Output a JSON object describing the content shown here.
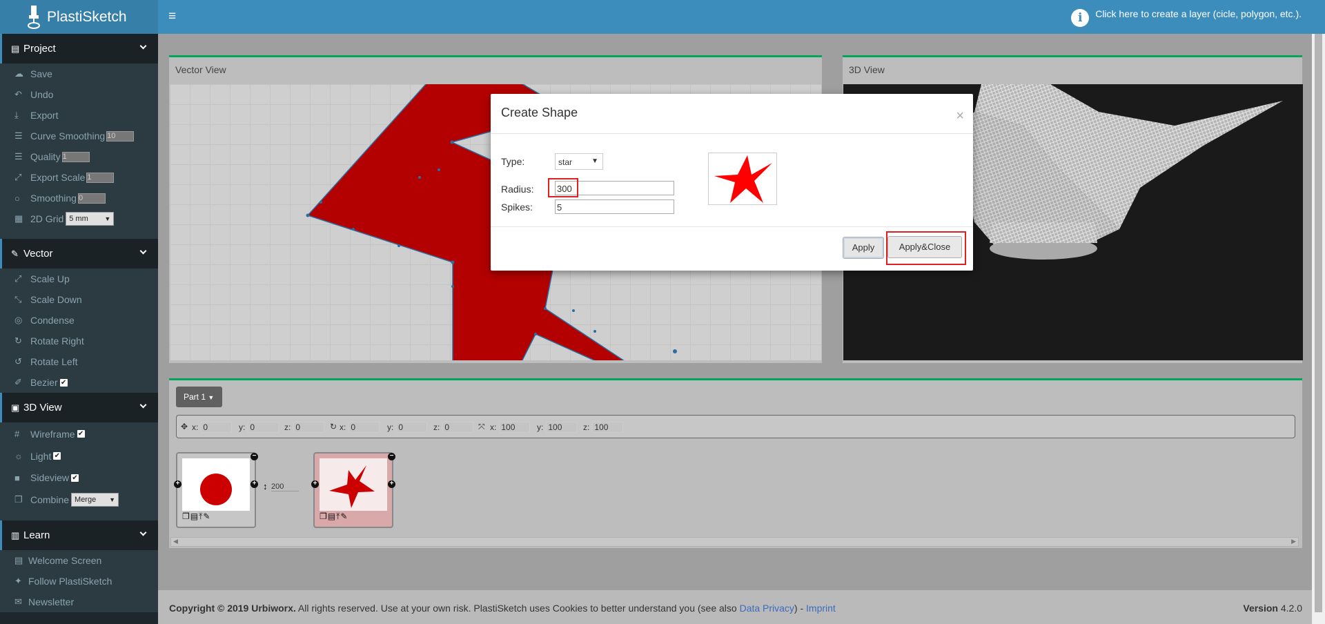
{
  "app": {
    "title": "PlastiSketch",
    "topbar_hint": "Click here to create a layer (cicle, polygon, etc.)."
  },
  "sidebar": {
    "project": {
      "title": "Project",
      "items": [
        {
          "label": "Save",
          "icon": "cloud-upload-icon"
        },
        {
          "label": "Undo",
          "icon": "undo-icon"
        },
        {
          "label": "Export",
          "icon": "download-icon"
        },
        {
          "label": "Curve Smoothing",
          "icon": "sliders-icon",
          "value": "10"
        },
        {
          "label": "Quality",
          "icon": "sliders-icon",
          "value": "1"
        },
        {
          "label": "Export Scale",
          "icon": "expand-icon",
          "value": "1"
        },
        {
          "label": "Smoothing",
          "icon": "circle-icon",
          "value": "0"
        },
        {
          "label": "2D Grid",
          "icon": "grid-icon",
          "value": "5 mm"
        }
      ]
    },
    "vector": {
      "title": "Vector",
      "items": [
        {
          "label": "Scale Up",
          "icon": "expand-arrows-icon"
        },
        {
          "label": "Scale Down",
          "icon": "compress-arrows-icon"
        },
        {
          "label": "Condense",
          "icon": "target-icon"
        },
        {
          "label": "Rotate Right",
          "icon": "rotate-right-icon"
        },
        {
          "label": "Rotate Left",
          "icon": "rotate-left-icon"
        },
        {
          "label": "Bezier",
          "icon": "brush-icon",
          "checked": true
        }
      ]
    },
    "view3d": {
      "title": "3D View",
      "items": [
        {
          "label": "Wireframe",
          "icon": "hash-icon",
          "checked": true
        },
        {
          "label": "Light",
          "icon": "lightbulb-icon",
          "checked": true
        },
        {
          "label": "Sideview",
          "icon": "camera-icon",
          "checked": true
        },
        {
          "label": "Combine",
          "icon": "copy-icon",
          "value": "Merge"
        }
      ]
    },
    "learn": {
      "title": "Learn",
      "items": [
        {
          "label": "Welcome Screen",
          "icon": "film-icon"
        },
        {
          "label": "Follow PlastiSketch",
          "icon": "twitter-icon"
        },
        {
          "label": "Newsletter",
          "icon": "envelope-icon"
        }
      ]
    }
  },
  "panels": {
    "vector_title": "Vector View",
    "view3d_title": "3D View"
  },
  "parts": {
    "dropdown": "Part 1",
    "transform": {
      "x": "0",
      "y": "0",
      "z": "0",
      "rx": "0",
      "ry": "0",
      "rz": "0",
      "sx": "100",
      "sy": "100",
      "sz": "100"
    },
    "layer_gap": "200"
  },
  "modal": {
    "title": "Create Shape",
    "close": "×",
    "type_label": "Type:",
    "type_value": "star",
    "radius_label": "Radius:",
    "radius_value": "300",
    "spikes_label": "Spikes:",
    "spikes_value": "5",
    "apply": "Apply",
    "apply_close": "Apply&Close"
  },
  "footer": {
    "copyright": "Copyright © 2019 Urbiworx.",
    "text": " All rights reserved. Use at your own risk. PlastiSketch uses Cookies to better understand you (see also ",
    "privacy": "Data Privacy",
    "sep": ") - ",
    "imprint": "Imprint",
    "version_label": "Version",
    "version": "4.2.0"
  },
  "colors": {
    "accent": "#3c8dbc",
    "sidebar": "#1e282c",
    "shape": "#c00000",
    "preview": "#ff0000",
    "highlight": "#e02020",
    "panel_border": "#00a65a"
  }
}
